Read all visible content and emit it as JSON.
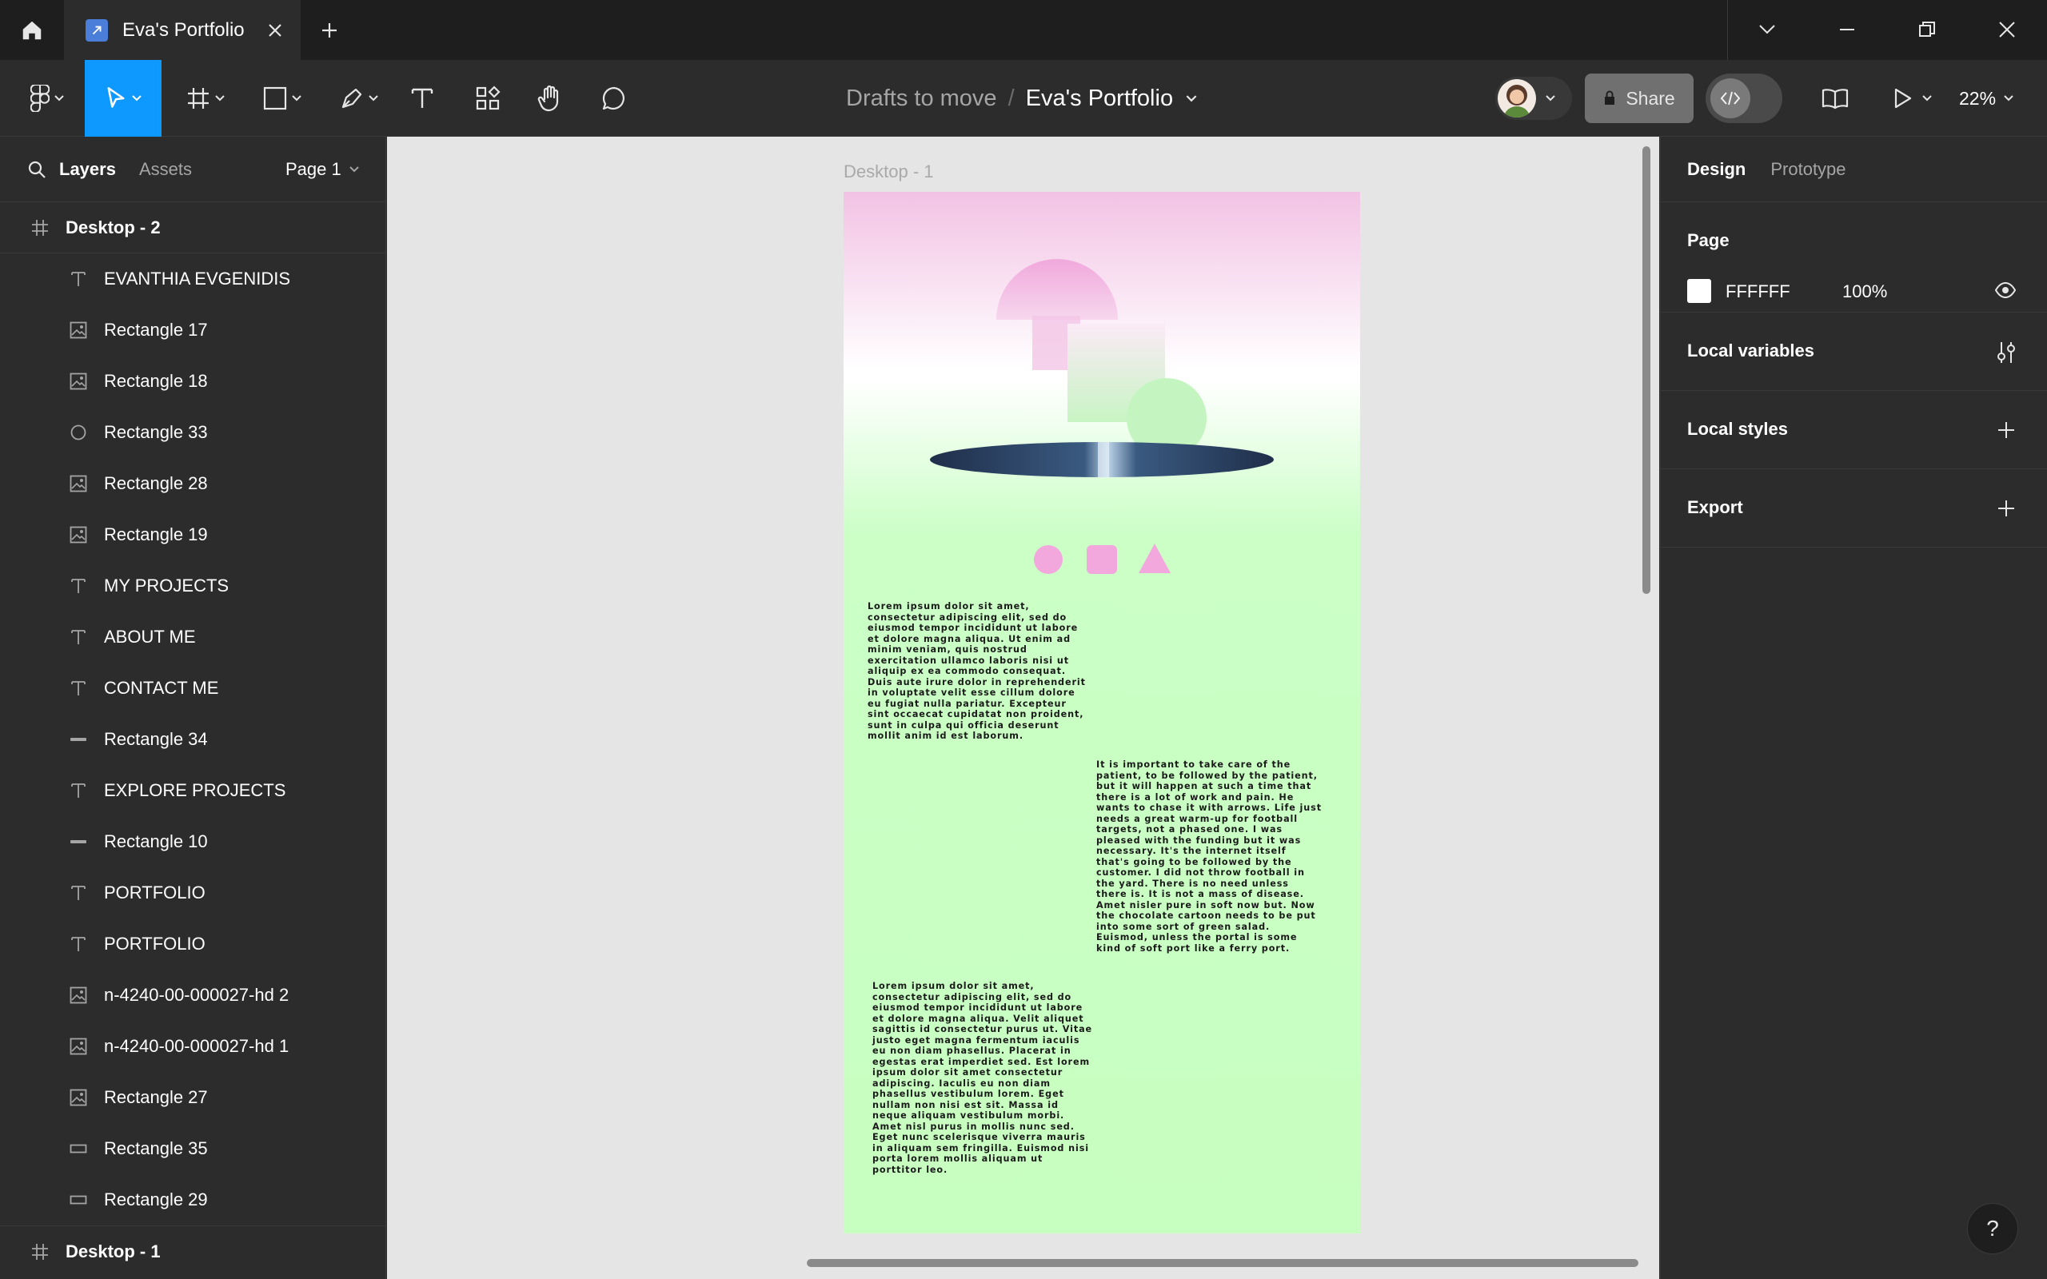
{
  "tab": {
    "title": "Eva's Portfolio"
  },
  "breadcrumb": {
    "folder": "Drafts to move",
    "separator": "/",
    "file": "Eva's Portfolio"
  },
  "toolbar": {
    "share_label": "Share",
    "zoom": "22%"
  },
  "left_panel": {
    "tabs": {
      "layers": "Layers",
      "assets": "Assets"
    },
    "page_selector": "Page 1",
    "layers": [
      {
        "name": "Desktop - 2",
        "icon": "frame-icon",
        "level": 0
      },
      {
        "name": "EVANTHIA EVGENIDIS",
        "icon": "text-icon",
        "level": 1
      },
      {
        "name": "Rectangle 17",
        "icon": "image-icon",
        "level": 1
      },
      {
        "name": "Rectangle 18",
        "icon": "image-icon",
        "level": 1
      },
      {
        "name": "Rectangle 33",
        "icon": "ellipse-icon",
        "level": 1
      },
      {
        "name": "Rectangle 28",
        "icon": "image-icon",
        "level": 1
      },
      {
        "name": "Rectangle 19",
        "icon": "image-icon",
        "level": 1
      },
      {
        "name": "MY PROJECTS",
        "icon": "text-icon",
        "level": 1
      },
      {
        "name": "ABOUT ME",
        "icon": "text-icon",
        "level": 1
      },
      {
        "name": "CONTACT ME",
        "icon": "text-icon",
        "level": 1
      },
      {
        "name": "Rectangle 34",
        "icon": "line-icon",
        "level": 1
      },
      {
        "name": "EXPLORE PROJECTS",
        "icon": "text-icon",
        "level": 1
      },
      {
        "name": "Rectangle 10",
        "icon": "line-icon",
        "level": 1
      },
      {
        "name": "PORTFOLIO",
        "icon": "text-icon",
        "level": 1
      },
      {
        "name": "PORTFOLIO",
        "icon": "text-icon",
        "level": 1
      },
      {
        "name": "n-4240-00-000027-hd 2",
        "icon": "image-icon",
        "level": 1
      },
      {
        "name": "n-4240-00-000027-hd 1",
        "icon": "image-icon",
        "level": 1
      },
      {
        "name": "Rectangle 27",
        "icon": "image-icon",
        "level": 1
      },
      {
        "name": "Rectangle 35",
        "icon": "rectangle-icon",
        "level": 1
      },
      {
        "name": "Rectangle 29",
        "icon": "rectangle-icon",
        "level": 1
      },
      {
        "name": "Desktop - 1",
        "icon": "frame-icon",
        "level": 0
      }
    ]
  },
  "canvas": {
    "frame_label": "Desktop - 1",
    "text_1": "Lorem ipsum dolor sit amet, consectetur adipiscing elit, sed do eiusmod tempor incididunt ut labore et dolore magna aliqua. Ut enim ad minim veniam, quis nostrud exercitation ullamco laboris nisi ut aliquip ex ea commodo consequat. Duis aute irure dolor in reprehenderit in voluptate velit esse cillum dolore eu fugiat nulla pariatur. Excepteur sint occaecat cupidatat non proident, sunt in culpa qui officia deserunt mollit anim id est laborum.",
    "text_2": "It is important to take care of the patient, to be followed by the patient, but it will happen at such a time that there is a lot of work and pain. He wants to chase it with arrows. Life just needs a great warm-up for football targets, not a phased one. I was pleased with the funding but it was necessary. It's the internet itself that's going to be followed by the customer. I did not throw football in the yard. There is no need unless there is. It is not a mass of disease. Amet nisler pure in soft now but. Now the chocolate cartoon needs to be put into some sort of green salad. Euismod, unless the portal is some kind of soft port like a ferry port.",
    "text_3": "Lorem ipsum dolor sit amet, consectetur adipiscing elit, sed do eiusmod tempor incididunt ut labore et dolore magna aliqua. Velit aliquet sagittis id consectetur purus ut. Vitae justo eget magna fermentum iaculis eu non diam phasellus. Placerat in egestas erat imperdiet sed. Est lorem ipsum dolor sit amet consectetur adipiscing. Iaculis eu non diam phasellus vestibulum lorem. Eget nullam non nisi est sit. Massa id neque aliquam vestibulum morbi. Amet nisl purus in mollis nunc sed. Eget nunc scelerisque viverra mauris in aliquam sem fringilla. Euismod nisi porta lorem mollis aliquam ut porttitor leo."
  },
  "right_panel": {
    "tabs": {
      "design": "Design",
      "prototype": "Prototype"
    },
    "page_section": {
      "title": "Page",
      "color_hex": "FFFFFF",
      "opacity": "100%"
    },
    "local_variables": "Local variables",
    "local_styles": "Local styles",
    "export": "Export"
  },
  "help_label": "?",
  "colors": {
    "accent": "#0d99ff",
    "canvas_bg": "#e5e5e5",
    "frame_top": "#f2c2e4",
    "frame_bottom": "#c7ffc0",
    "shape_pink": "#f2a8dc"
  }
}
